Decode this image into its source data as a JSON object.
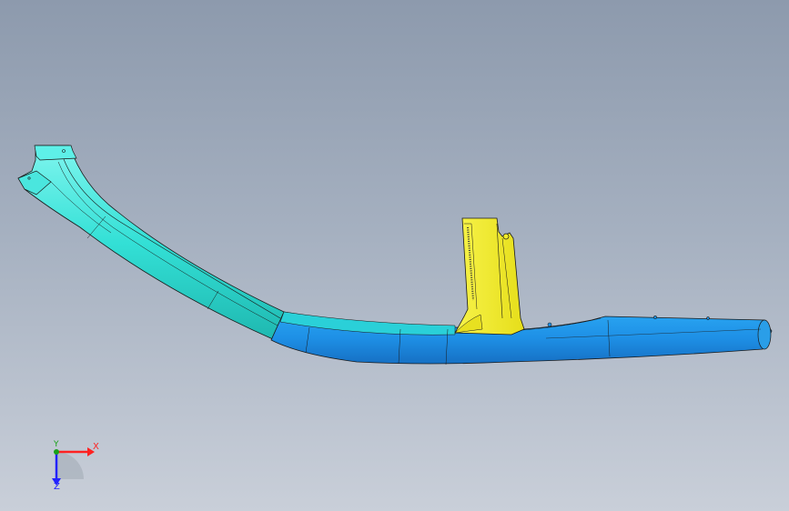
{
  "viewport": {
    "background_top": "#8d9aad",
    "background_bottom": "#c9cfd9"
  },
  "model": {
    "parts": [
      {
        "name": "upper-tube",
        "color": "#33e0d6"
      },
      {
        "name": "lower-tube",
        "color": "#1e90e6"
      },
      {
        "name": "bracket",
        "color": "#f2ec2a"
      }
    ]
  },
  "triad": {
    "x_label": "X",
    "y_label": "Y",
    "z_label": "Z",
    "x_color": "#ff2222",
    "y_color": "#18a018",
    "z_color": "#2222ff"
  }
}
